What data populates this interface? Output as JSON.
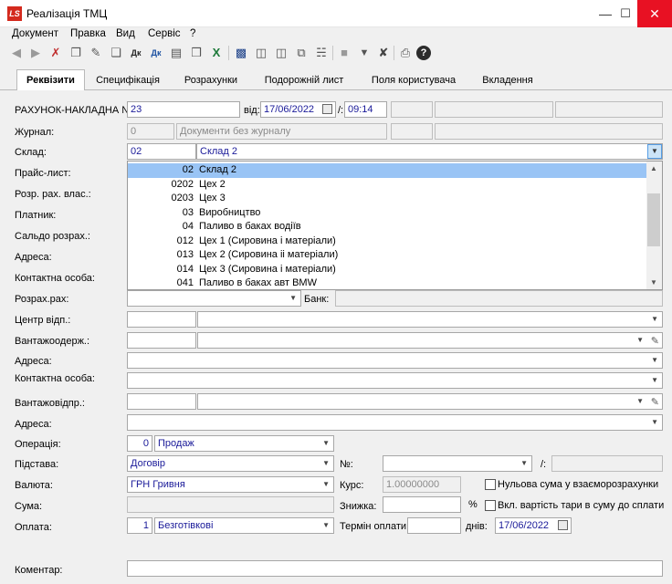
{
  "window": {
    "title": "Реалізація ТМЦ",
    "logo": "LS"
  },
  "menu": [
    "Документ",
    "Правка",
    "Вид",
    "Сервіс",
    "?"
  ],
  "tabs": [
    "Реквізити",
    "Специфікація",
    "Розрахунки",
    "Подорожній лист",
    "Поля користувача",
    "Вкладення"
  ],
  "form": {
    "invoice_label": "РАХУНОК-НАКЛАДНА №:",
    "invoice_number": "23",
    "date_label": "від:",
    "date": "17/06/2022",
    "time_sep": "/:",
    "time": "09:14",
    "journal_label": "Журнал:",
    "journal_code": "0",
    "journal_name": "Документи без журналу",
    "warehouse_label": "Склад:",
    "warehouse_code": "02",
    "warehouse_name": "Склад 2",
    "pricelist_label": "Прайс-лист:",
    "own_account_label": "Розр. рах. влас.:",
    "payer_label": "Платник:",
    "balance_label": "Сальдо розрах.:",
    "address_label": "Адреса:",
    "contact_label": "Контактна особа:",
    "account_label": "Розрах.рах:",
    "bank_label": "Банк:",
    "dispatch_center_label": "Центр відп.:",
    "consignee_label": "Вантажоодерж.:",
    "address2_label": "Адреса:",
    "contact2_label": "Контактна особа:",
    "shipper_label": "Вантажовідпр.:",
    "address3_label": "Адреса:",
    "operation_label": "Операція:",
    "operation_code": "0",
    "operation_name": "Продаж",
    "basis_label": "Підстава:",
    "basis_value": "Договір",
    "number_label": "№:",
    "number_sep": "/:",
    "currency_label": "Валюта:",
    "currency_value": "ГРН Гривня",
    "rate_label": "Курс:",
    "rate_value": "1.00000000",
    "zero_sum_label": "Нульова сума у взаєморозрахунки",
    "sum_label": "Сума:",
    "discount_label": "Знижка:",
    "percent": "%",
    "tare_label": "Вкл. вартість тари в суму до сплати",
    "payment_label": "Оплата:",
    "payment_code": "1",
    "payment_name": "Безготівкові",
    "pay_term_label": "Термін оплати:",
    "days_label": "днів:",
    "pay_date": "17/06/2022",
    "comment_label": "Коментар:"
  },
  "dropdown_items": [
    {
      "code": "02",
      "name": "Склад 2",
      "selected": true
    },
    {
      "code": "0202",
      "name": "Цех 2"
    },
    {
      "code": "0203",
      "name": "Цех 3"
    },
    {
      "code": "03",
      "name": "Виробництво"
    },
    {
      "code": "04",
      "name": "Паливо в баках водіїв"
    },
    {
      "code": "012",
      "name": "Цех 1 (Сировина і матеріали)"
    },
    {
      "code": "013",
      "name": "Цех 2 (Сировина іі  матеріали)"
    },
    {
      "code": "014",
      "name": "Цех 3 (Сировина і матеріали)"
    },
    {
      "code": "041",
      "name": "Паливо в баках авт BMW"
    }
  ]
}
